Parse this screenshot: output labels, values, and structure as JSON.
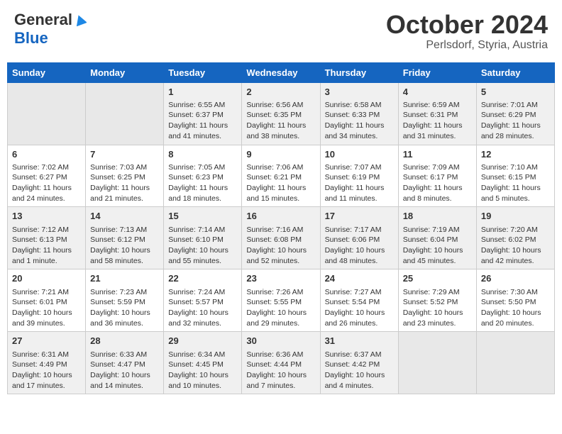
{
  "header": {
    "logo_general": "General",
    "logo_blue": "Blue",
    "month_title": "October 2024",
    "location": "Perlsdorf, Styria, Austria"
  },
  "weekdays": [
    "Sunday",
    "Monday",
    "Tuesday",
    "Wednesday",
    "Thursday",
    "Friday",
    "Saturday"
  ],
  "weeks": [
    [
      {
        "day": "",
        "empty": true
      },
      {
        "day": "",
        "empty": true
      },
      {
        "day": "1",
        "sunrise": "Sunrise: 6:55 AM",
        "sunset": "Sunset: 6:37 PM",
        "daylight": "Daylight: 11 hours and 41 minutes."
      },
      {
        "day": "2",
        "sunrise": "Sunrise: 6:56 AM",
        "sunset": "Sunset: 6:35 PM",
        "daylight": "Daylight: 11 hours and 38 minutes."
      },
      {
        "day": "3",
        "sunrise": "Sunrise: 6:58 AM",
        "sunset": "Sunset: 6:33 PM",
        "daylight": "Daylight: 11 hours and 34 minutes."
      },
      {
        "day": "4",
        "sunrise": "Sunrise: 6:59 AM",
        "sunset": "Sunset: 6:31 PM",
        "daylight": "Daylight: 11 hours and 31 minutes."
      },
      {
        "day": "5",
        "sunrise": "Sunrise: 7:01 AM",
        "sunset": "Sunset: 6:29 PM",
        "daylight": "Daylight: 11 hours and 28 minutes."
      }
    ],
    [
      {
        "day": "6",
        "sunrise": "Sunrise: 7:02 AM",
        "sunset": "Sunset: 6:27 PM",
        "daylight": "Daylight: 11 hours and 24 minutes."
      },
      {
        "day": "7",
        "sunrise": "Sunrise: 7:03 AM",
        "sunset": "Sunset: 6:25 PM",
        "daylight": "Daylight: 11 hours and 21 minutes."
      },
      {
        "day": "8",
        "sunrise": "Sunrise: 7:05 AM",
        "sunset": "Sunset: 6:23 PM",
        "daylight": "Daylight: 11 hours and 18 minutes."
      },
      {
        "day": "9",
        "sunrise": "Sunrise: 7:06 AM",
        "sunset": "Sunset: 6:21 PM",
        "daylight": "Daylight: 11 hours and 15 minutes."
      },
      {
        "day": "10",
        "sunrise": "Sunrise: 7:07 AM",
        "sunset": "Sunset: 6:19 PM",
        "daylight": "Daylight: 11 hours and 11 minutes."
      },
      {
        "day": "11",
        "sunrise": "Sunrise: 7:09 AM",
        "sunset": "Sunset: 6:17 PM",
        "daylight": "Daylight: 11 hours and 8 minutes."
      },
      {
        "day": "12",
        "sunrise": "Sunrise: 7:10 AM",
        "sunset": "Sunset: 6:15 PM",
        "daylight": "Daylight: 11 hours and 5 minutes."
      }
    ],
    [
      {
        "day": "13",
        "sunrise": "Sunrise: 7:12 AM",
        "sunset": "Sunset: 6:13 PM",
        "daylight": "Daylight: 11 hours and 1 minute."
      },
      {
        "day": "14",
        "sunrise": "Sunrise: 7:13 AM",
        "sunset": "Sunset: 6:12 PM",
        "daylight": "Daylight: 10 hours and 58 minutes."
      },
      {
        "day": "15",
        "sunrise": "Sunrise: 7:14 AM",
        "sunset": "Sunset: 6:10 PM",
        "daylight": "Daylight: 10 hours and 55 minutes."
      },
      {
        "day": "16",
        "sunrise": "Sunrise: 7:16 AM",
        "sunset": "Sunset: 6:08 PM",
        "daylight": "Daylight: 10 hours and 52 minutes."
      },
      {
        "day": "17",
        "sunrise": "Sunrise: 7:17 AM",
        "sunset": "Sunset: 6:06 PM",
        "daylight": "Daylight: 10 hours and 48 minutes."
      },
      {
        "day": "18",
        "sunrise": "Sunrise: 7:19 AM",
        "sunset": "Sunset: 6:04 PM",
        "daylight": "Daylight: 10 hours and 45 minutes."
      },
      {
        "day": "19",
        "sunrise": "Sunrise: 7:20 AM",
        "sunset": "Sunset: 6:02 PM",
        "daylight": "Daylight: 10 hours and 42 minutes."
      }
    ],
    [
      {
        "day": "20",
        "sunrise": "Sunrise: 7:21 AM",
        "sunset": "Sunset: 6:01 PM",
        "daylight": "Daylight: 10 hours and 39 minutes."
      },
      {
        "day": "21",
        "sunrise": "Sunrise: 7:23 AM",
        "sunset": "Sunset: 5:59 PM",
        "daylight": "Daylight: 10 hours and 36 minutes."
      },
      {
        "day": "22",
        "sunrise": "Sunrise: 7:24 AM",
        "sunset": "Sunset: 5:57 PM",
        "daylight": "Daylight: 10 hours and 32 minutes."
      },
      {
        "day": "23",
        "sunrise": "Sunrise: 7:26 AM",
        "sunset": "Sunset: 5:55 PM",
        "daylight": "Daylight: 10 hours and 29 minutes."
      },
      {
        "day": "24",
        "sunrise": "Sunrise: 7:27 AM",
        "sunset": "Sunset: 5:54 PM",
        "daylight": "Daylight: 10 hours and 26 minutes."
      },
      {
        "day": "25",
        "sunrise": "Sunrise: 7:29 AM",
        "sunset": "Sunset: 5:52 PM",
        "daylight": "Daylight: 10 hours and 23 minutes."
      },
      {
        "day": "26",
        "sunrise": "Sunrise: 7:30 AM",
        "sunset": "Sunset: 5:50 PM",
        "daylight": "Daylight: 10 hours and 20 minutes."
      }
    ],
    [
      {
        "day": "27",
        "sunrise": "Sunrise: 6:31 AM",
        "sunset": "Sunset: 4:49 PM",
        "daylight": "Daylight: 10 hours and 17 minutes."
      },
      {
        "day": "28",
        "sunrise": "Sunrise: 6:33 AM",
        "sunset": "Sunset: 4:47 PM",
        "daylight": "Daylight: 10 hours and 14 minutes."
      },
      {
        "day": "29",
        "sunrise": "Sunrise: 6:34 AM",
        "sunset": "Sunset: 4:45 PM",
        "daylight": "Daylight: 10 hours and 10 minutes."
      },
      {
        "day": "30",
        "sunrise": "Sunrise: 6:36 AM",
        "sunset": "Sunset: 4:44 PM",
        "daylight": "Daylight: 10 hours and 7 minutes."
      },
      {
        "day": "31",
        "sunrise": "Sunrise: 6:37 AM",
        "sunset": "Sunset: 4:42 PM",
        "daylight": "Daylight: 10 hours and 4 minutes."
      },
      {
        "day": "",
        "empty": true
      },
      {
        "day": "",
        "empty": true
      }
    ]
  ]
}
